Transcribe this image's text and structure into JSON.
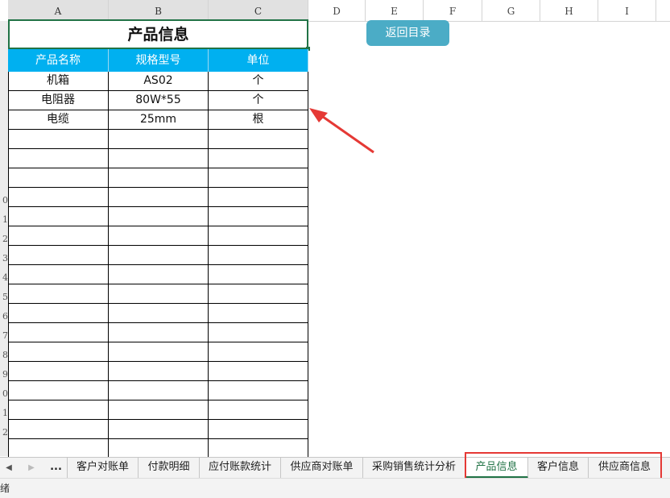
{
  "columns": [
    "A",
    "B",
    "C",
    "D",
    "E",
    "F",
    "G",
    "H",
    "I"
  ],
  "row_numbers": [
    "",
    "",
    "",
    "",
    "",
    "",
    "",
    "",
    "",
    "0",
    "1",
    "2",
    "3",
    "4",
    "5",
    "6",
    "7",
    "8",
    "9",
    "0",
    "1",
    "2"
  ],
  "sheet": {
    "title": "产品信息",
    "headers": [
      "产品名称",
      "规格型号",
      "单位"
    ],
    "rows": [
      [
        "机箱",
        "AS02",
        "个"
      ],
      [
        "电阻器",
        "80W*55",
        "个"
      ],
      [
        "电缆",
        "25mm",
        "根"
      ]
    ]
  },
  "back_button": {
    "label": "返回目录"
  },
  "tabs": {
    "ellipsis": "...",
    "items": [
      "客户对账单",
      "付款明细",
      "应付账款统计",
      "供应商对账单",
      "采购销售统计分析",
      "产品信息",
      "客户信息",
      "供应商信息"
    ],
    "active": "产品信息"
  },
  "status": {
    "text": "绪"
  },
  "colors": {
    "header_fill": "#00b0f0",
    "button_fill": "#4bacc6",
    "active_tab": "#217346",
    "annotation": "#e53935"
  },
  "icons": {
    "prev_sheet": "triangle-left-icon",
    "next_sheet": "triangle-right-icon",
    "annotation_arrow": "arrow-icon"
  }
}
